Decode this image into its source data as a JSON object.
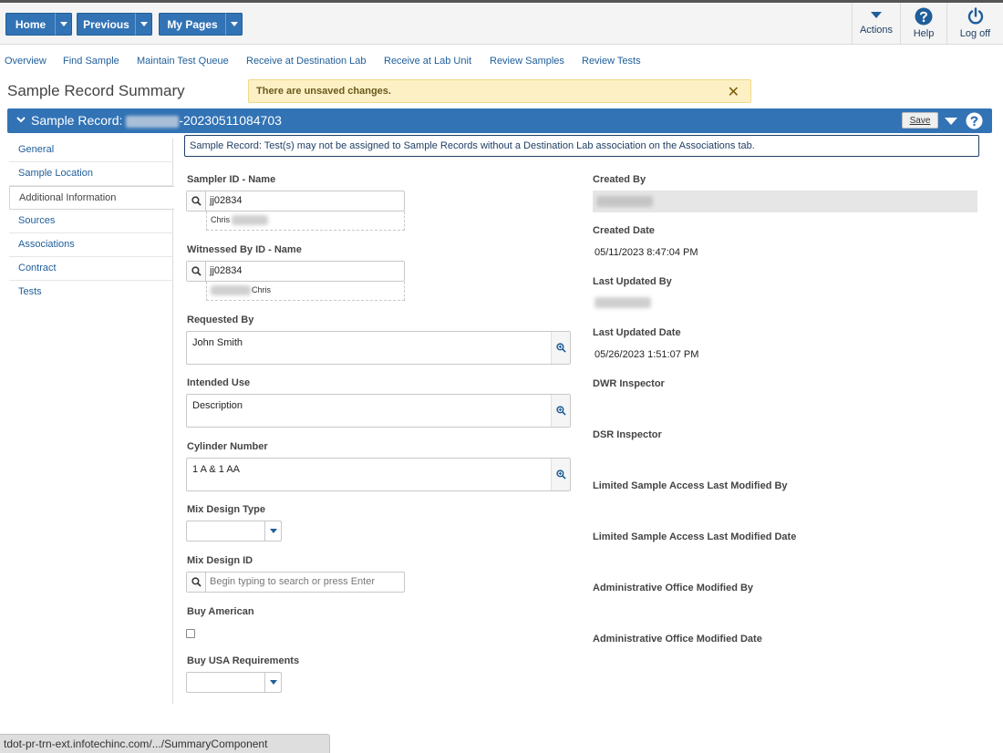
{
  "topbar": {
    "home_label": "Home",
    "previous_label": "Previous",
    "mypages_label": "My Pages",
    "actions_label": "Actions",
    "help_label": "Help",
    "logoff_label": "Log off"
  },
  "nav": {
    "links": [
      "Overview",
      "Find Sample",
      "Maintain Test Queue",
      "Receive at Destination Lab",
      "Receive at Lab Unit",
      "Review Samples",
      "Review Tests"
    ]
  },
  "page": {
    "title": "Sample Record Summary",
    "unsaved_message": "There are unsaved changes.",
    "close_glyph": "✕"
  },
  "section": {
    "title_prefix": "Sample Record: ",
    "title_suffix": "-20230511084703",
    "save_label": "Save"
  },
  "sidebar": {
    "items": [
      "General",
      "Sample Location",
      "Additional Information",
      "Sources",
      "Associations",
      "Contract",
      "Tests"
    ],
    "active_index": 2
  },
  "info_message": "Sample Record: Test(s) may not be assigned to Sample Records without a Destination Lab association on the Associations tab.",
  "form": {
    "sampler_label": "Sampler ID - Name",
    "sampler_id": "jj02834",
    "sampler_name": "Chris",
    "witness_label": "Witnessed By ID - Name",
    "witness_id": "jj02834",
    "witness_name": "Chris",
    "requested_label": "Requested By",
    "requested_value": "John Smith",
    "intended_label": "Intended Use",
    "intended_value": "Description",
    "cylinder_label": "Cylinder Number",
    "cylinder_value": "1 A & 1 AA",
    "mixtype_label": "Mix Design Type",
    "mixid_label": "Mix Design ID",
    "mixid_placeholder": "Begin typing to search or press Enter",
    "buyamerican_label": "Buy American",
    "buyusa_label": "Buy USA Requirements"
  },
  "right": {
    "created_by_label": "Created By",
    "created_date_label": "Created Date",
    "created_date": "05/11/2023 8:47:04 PM",
    "updated_by_label": "Last Updated By",
    "updated_date_label": "Last Updated Date",
    "updated_date": "05/26/2023 1:51:07 PM",
    "dwr_label": "DWR Inspector",
    "dsr_label": "DSR Inspector",
    "lsa_by_label": "Limited Sample Access Last Modified By",
    "lsa_date_label": "Limited Sample Access Last Modified Date",
    "admin_by_label": "Administrative Office Modified By",
    "admin_date_label": "Administrative Office Modified Date"
  },
  "status_url": "tdot-pr-trn-ext.infotechinc.com/.../SummaryComponent",
  "colors": {
    "primary": "#3273b5",
    "link": "#1f5e9a",
    "warning_bg": "#fdf0c4"
  }
}
